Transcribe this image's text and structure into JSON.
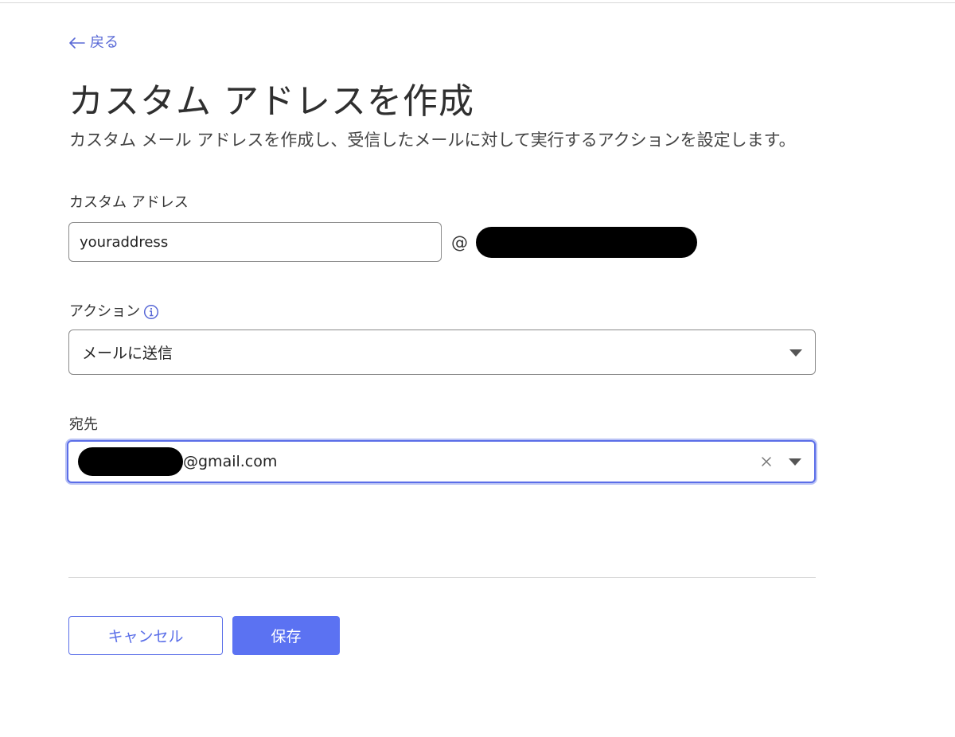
{
  "nav": {
    "back_label": "戻る"
  },
  "header": {
    "title": "カスタム アドレスを作成",
    "subtitle": "カスタム メール アドレスを作成し、受信したメールに対して実行するアクションを設定します。"
  },
  "custom_address": {
    "label": "カスタム アドレス",
    "value": "youraddress",
    "at_sign": "@"
  },
  "action": {
    "label": "アクション",
    "selected": "メールに送信"
  },
  "destination": {
    "label": "宛先",
    "email_suffix": "@gmail.com"
  },
  "buttons": {
    "cancel": "キャンセル",
    "save": "保存"
  },
  "colors": {
    "accent": "#5b72f2",
    "link": "#5868d6",
    "focus_ring": "#5b6ee8"
  }
}
